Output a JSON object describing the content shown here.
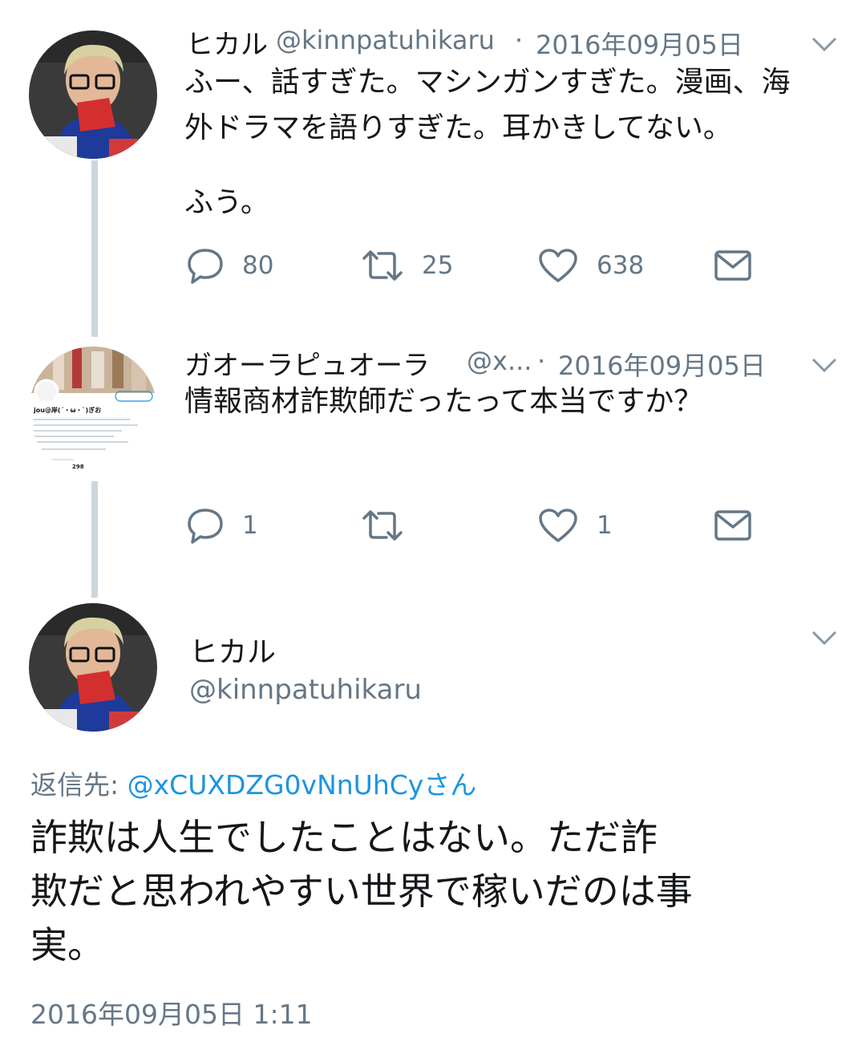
{
  "tweet1": {
    "name": "ヒカル",
    "handle": "@kinnpatuhikaru",
    "separator": "·",
    "date": "2016年09月05日",
    "text_line1": "ふー、話すぎた。マシンガンすぎた。漫画、海",
    "text_line2": "外ドラマを語りすぎた。耳かきしてない。",
    "text_line3": "ふう。",
    "replies": "80",
    "retweets": "25",
    "likes": "638"
  },
  "tweet2": {
    "name": "ガオーラピュオーラ",
    "handle": "@x...",
    "separator": "·",
    "date": "2016年09月05日",
    "text": "情報商材詐欺師だったって本当ですか？",
    "replies": "1",
    "retweets": "",
    "likes": "1",
    "avatar_profile_name": "jou@岸(´・ω・`)ぎお",
    "avatar_followers": "298"
  },
  "tweet3": {
    "name": "ヒカル",
    "handle": "@kinnpatuhikaru",
    "reply_to_label": "返信先:",
    "reply_to_user": "@xCUXDZG0vNnUhCyさん",
    "text_line1": "詐欺は人生でしたことはない。ただ詐",
    "text_line2": "欺だと思われやすい世界で稼いだのは事",
    "text_line3": "実。",
    "timestamp": "2016年09月05日 1:11"
  },
  "colors": {
    "link": "#1b95e0",
    "meta": "#657786",
    "icon": "#657786",
    "thread_line": "#ccd6dd"
  },
  "icons": [
    "reply-icon",
    "retweet-icon",
    "like-icon",
    "dm-icon",
    "chevron-down-icon"
  ]
}
